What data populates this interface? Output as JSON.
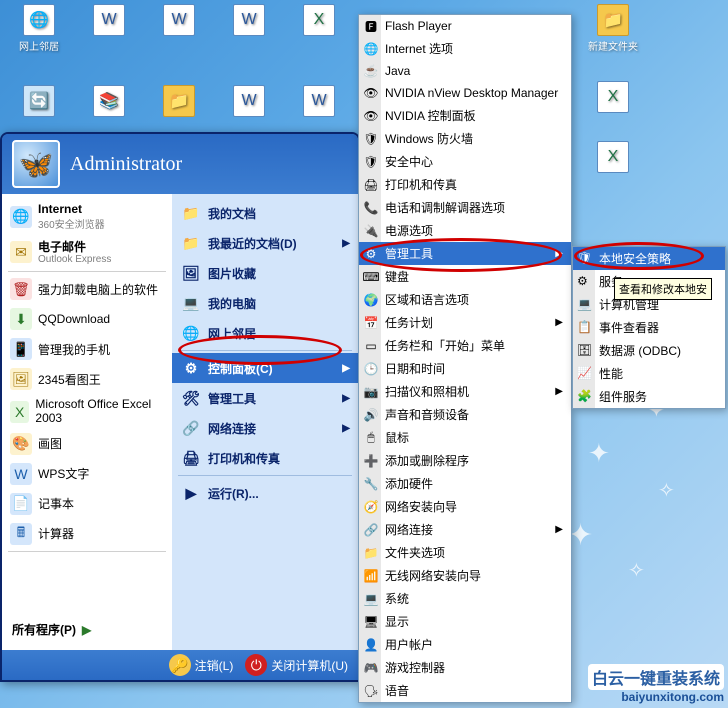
{
  "desktop": {
    "row1": [
      {
        "label": "网上邻居",
        "icon": "🌐"
      },
      {
        "label": "",
        "icon": "W"
      },
      {
        "label": "",
        "icon": "W"
      },
      {
        "label": "",
        "icon": "W"
      },
      {
        "label": "",
        "icon": "X"
      }
    ],
    "row2": [
      {
        "label": "",
        "icon": "🔄"
      },
      {
        "label": "",
        "icon": "📚"
      },
      {
        "label": "",
        "icon": "📁"
      },
      {
        "label": "",
        "icon": "W"
      },
      {
        "label": "",
        "icon": "W"
      }
    ],
    "far1": [
      {
        "label": "新建文件夹",
        "icon": "📁"
      },
      {
        "label": "",
        "icon": "X"
      },
      {
        "label": "",
        "icon": "X"
      }
    ]
  },
  "startmenu": {
    "user": "Administrator",
    "left": [
      {
        "title": "Internet",
        "sub": "360安全浏览器",
        "icon": "🌐"
      },
      {
        "title": "电子邮件",
        "sub": "Outlook Express",
        "icon": "✉"
      },
      {
        "title": "强力卸载电脑上的软件",
        "icon": "🗑"
      },
      {
        "title": "QQDownload",
        "icon": "⬇"
      },
      {
        "title": "管理我的手机",
        "icon": "📱"
      },
      {
        "title": "2345看图王",
        "icon": "🖼"
      },
      {
        "title": "Microsoft Office Excel 2003",
        "icon": "X"
      },
      {
        "title": "画图",
        "icon": "🎨"
      },
      {
        "title": "WPS文字",
        "icon": "W"
      },
      {
        "title": "记事本",
        "icon": "📄"
      },
      {
        "title": "计算器",
        "icon": "🖩"
      }
    ],
    "all_programs": "所有程序(P)",
    "right": [
      {
        "label": "我的文档",
        "icon": "📁"
      },
      {
        "label": "我最近的文档(D)",
        "icon": "📁",
        "arrow": true
      },
      {
        "label": "图片收藏",
        "icon": "🖼"
      },
      {
        "label": "我的电脑",
        "icon": "💻"
      },
      {
        "label": "网上邻居",
        "icon": "🌐"
      },
      {
        "sep": true
      },
      {
        "label": "控制面板(C)",
        "icon": "⚙",
        "arrow": true,
        "hl": true
      },
      {
        "label": "管理工具",
        "icon": "🛠",
        "arrow": true
      },
      {
        "label": "网络连接",
        "icon": "🔗",
        "arrow": true
      },
      {
        "label": "打印机和传真",
        "icon": "🖨"
      },
      {
        "sep": true
      },
      {
        "label": "运行(R)...",
        "icon": "▶"
      }
    ],
    "logoff": "注销(L)",
    "shutdown": "关闭计算机(U)"
  },
  "submenu1": [
    {
      "label": "Flash Player",
      "icon": "🅵"
    },
    {
      "label": "Internet 选项",
      "icon": "🌐"
    },
    {
      "label": "Java",
      "icon": "☕"
    },
    {
      "label": "NVIDIA nView Desktop Manager",
      "icon": "👁"
    },
    {
      "label": "NVIDIA 控制面板",
      "icon": "👁"
    },
    {
      "label": "Windows 防火墙",
      "icon": "🛡"
    },
    {
      "label": "安全中心",
      "icon": "🛡"
    },
    {
      "label": "打印机和传真",
      "icon": "🖨"
    },
    {
      "label": "电话和调制解调器选项",
      "icon": "📞"
    },
    {
      "label": "电源选项",
      "icon": "🔌"
    },
    {
      "label": "管理工具",
      "icon": "⚙",
      "arrow": true,
      "hl": true
    },
    {
      "label": "键盘",
      "icon": "⌨"
    },
    {
      "label": "区域和语言选项",
      "icon": "🌍"
    },
    {
      "label": "任务计划",
      "icon": "📅",
      "arrow": true
    },
    {
      "label": "任务栏和「开始」菜单",
      "icon": "▭"
    },
    {
      "label": "日期和时间",
      "icon": "🕒"
    },
    {
      "label": "扫描仪和照相机",
      "icon": "📷",
      "arrow": true
    },
    {
      "label": "声音和音频设备",
      "icon": "🔊"
    },
    {
      "label": "鼠标",
      "icon": "🖱"
    },
    {
      "label": "添加或删除程序",
      "icon": "➕"
    },
    {
      "label": "添加硬件",
      "icon": "🔧"
    },
    {
      "label": "网络安装向导",
      "icon": "🧭"
    },
    {
      "label": "网络连接",
      "icon": "🔗",
      "arrow": true
    },
    {
      "label": "文件夹选项",
      "icon": "📁"
    },
    {
      "label": "无线网络安装向导",
      "icon": "📶"
    },
    {
      "label": "系统",
      "icon": "💻"
    },
    {
      "label": "显示",
      "icon": "🖥"
    },
    {
      "label": "用户帐户",
      "icon": "👤"
    },
    {
      "label": "游戏控制器",
      "icon": "🎮"
    },
    {
      "label": "语音",
      "icon": "🗣"
    }
  ],
  "submenu2": [
    {
      "label": "本地安全策略",
      "icon": "🛡",
      "hl": true
    },
    {
      "label": "服务",
      "icon": "⚙"
    },
    {
      "label": "计算机管理",
      "icon": "💻"
    },
    {
      "label": "事件查看器",
      "icon": "📋"
    },
    {
      "label": "数据源 (ODBC)",
      "icon": "🗄"
    },
    {
      "label": "性能",
      "icon": "📈"
    },
    {
      "label": "组件服务",
      "icon": "🧩"
    }
  ],
  "tooltip": "查看和修改本地安",
  "watermark": {
    "title": "白云一键重装系统",
    "url": "baiyunxitong.com"
  }
}
